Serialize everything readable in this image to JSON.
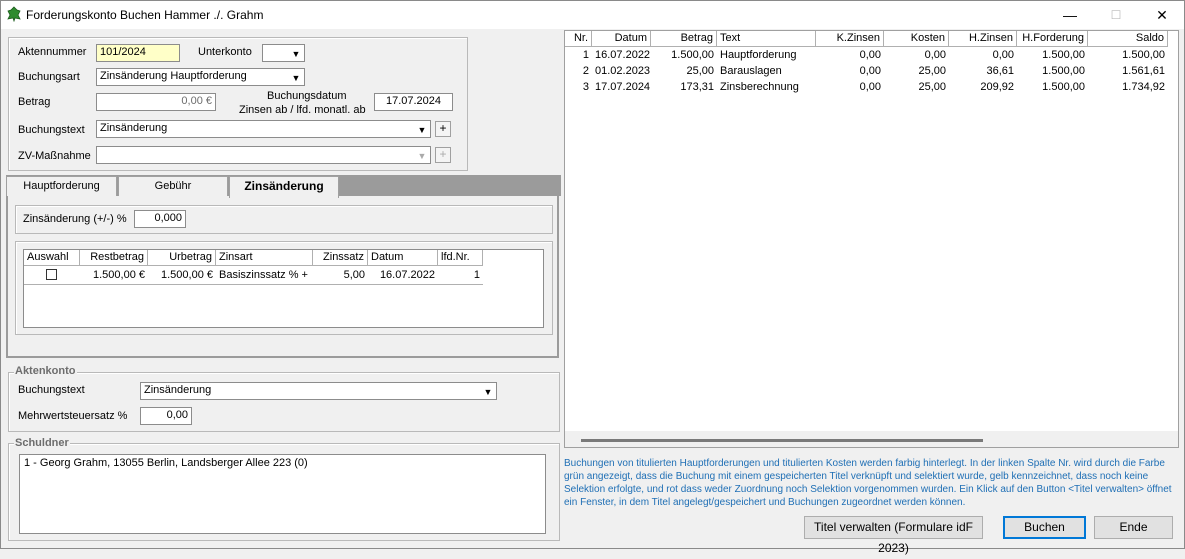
{
  "window": {
    "title": "Forderungskonto Buchen Hammer ./. Grahm",
    "minimize": "—",
    "maximize": "☐",
    "close": "✕"
  },
  "form": {
    "aktennummer_label": "Aktennummer",
    "aktennummer_value": "101/2024",
    "unterkonto_label": "Unterkonto",
    "unterkonto_value": "",
    "buchungsart_label": "Buchungsart",
    "buchungsart_value": "Zinsänderung Hauptforderung",
    "betrag_label": "Betrag",
    "betrag_value": "0,00 €",
    "buchungsdatum_label_1": "Buchungsdatum",
    "buchungsdatum_label_2": "Zinsen ab / lfd. monatl. ab",
    "buchungsdatum_value": "17.07.2024",
    "buchungstext_label": "Buchungstext",
    "buchungstext_value": "Zinsänderung",
    "zv_label": "ZV-Maßnahme",
    "zv_value": "",
    "plus": "+"
  },
  "tabs": [
    {
      "label": "Hauptforderung"
    },
    {
      "label": "Gebühr"
    },
    {
      "label": "Zinsänderung"
    }
  ],
  "zins": {
    "label": "Zinsänderung (+/-) %",
    "value": "0,000",
    "columns": [
      "Auswahl",
      "Restbetrag",
      "Urbetrag",
      "Zinsart",
      "Zinssatz",
      "Datum",
      "lfd.Nr."
    ],
    "rows": [
      {
        "restbetrag": "1.500,00 €",
        "urbetrag": "1.500,00 €",
        "zinsart": "Basiszinssatz % +",
        "zinssatz": "5,00",
        "datum": "16.07.2022",
        "lfdnr": "1"
      }
    ]
  },
  "aktenkonto": {
    "legend": "Aktenkonto",
    "buchungstext_label": "Buchungstext",
    "buchungstext_value": "Zinsänderung",
    "mwst_label": "Mehrwertsteuersatz %",
    "mwst_value": "0,00"
  },
  "schuldner": {
    "legend": "Schuldner",
    "entry": "1 - Georg Grahm, 13055 Berlin, Landsberger Allee 223 (0)"
  },
  "ledger": {
    "columns": [
      "Nr.",
      "Datum",
      "Betrag",
      "Text",
      "K.Zinsen",
      "Kosten",
      "H.Zinsen",
      "H.Forderung",
      "Saldo"
    ],
    "rows": [
      {
        "nr": "1",
        "datum": "16.07.2022",
        "betrag": "1.500,00",
        "text": "Hauptforderung",
        "kzinsen": "0,00",
        "kosten": "0,00",
        "hzinsen": "0,00",
        "hforderung": "1.500,00",
        "saldo": "1.500,00"
      },
      {
        "nr": "2",
        "datum": "01.02.2023",
        "betrag": "25,00",
        "text": "Barauslagen",
        "kzinsen": "0,00",
        "kosten": "25,00",
        "hzinsen": "36,61",
        "hforderung": "1.500,00",
        "saldo": "1.561,61"
      },
      {
        "nr": "3",
        "datum": "17.07.2024",
        "betrag": "173,31",
        "text": "Zinsberechnung",
        "kzinsen": "0,00",
        "kosten": "25,00",
        "hzinsen": "209,92",
        "hforderung": "1.500,00",
        "saldo": "1.734,92"
      }
    ]
  },
  "info_text": "Buchungen von titulierten Hauptforderungen und titulierten Kosten werden farbig hinterlegt. In der linken Spalte Nr. wird durch die Farbe grün angezeigt, dass die Buchung mit einem gespeicherten Titel verknüpft und selektiert wurde, gelb kennzeichnet, dass noch keine Selektion erfolgte, und rot dass weder Zuordnung noch Selektion vorgenommen wurden. Ein Klick auf den Button <Titel verwalten> öffnet ein Fenster, in dem Titel angelegt/gespeichert und Buchungen zugeordnet werden können.",
  "buttons": {
    "titel": "Titel verwalten (Formulare idF 2023)",
    "buchen": "Buchen",
    "ende": "Ende"
  },
  "colors": {
    "accent": "#0078d7",
    "info_text": "#1f6fb5",
    "aktennummer_bg": "#ffffc8",
    "app_icon": "#2e8b2e"
  }
}
